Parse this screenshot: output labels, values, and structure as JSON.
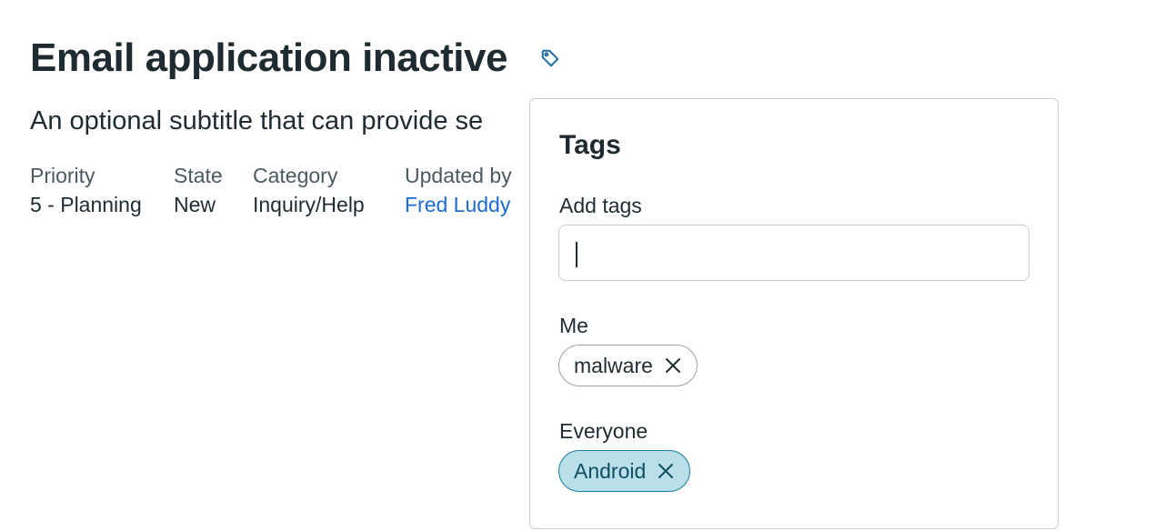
{
  "header": {
    "title": "Email application inactive",
    "subtitle": "An optional subtitle that can provide se",
    "tag_icon": "tag-icon"
  },
  "meta": [
    {
      "label": "Priority",
      "value": "5 - Planning"
    },
    {
      "label": "State",
      "value": "New"
    },
    {
      "label": "Category",
      "value": "Inquiry/Help"
    },
    {
      "label": "Updated by",
      "value": "Fred Luddy"
    }
  ],
  "tags_popover": {
    "title": "Tags",
    "add_label": "Add tags",
    "input_value": "",
    "me_label": "Me",
    "me_tags": [
      "malware"
    ],
    "everyone_label": "Everyone",
    "everyone_tags": [
      "Android"
    ],
    "remove_icon": "close-icon"
  },
  "colors": {
    "link": "#1c6bd1",
    "chip_everyone_bg": "#b9dfe8",
    "chip_everyone_border": "#1f7fa0"
  }
}
